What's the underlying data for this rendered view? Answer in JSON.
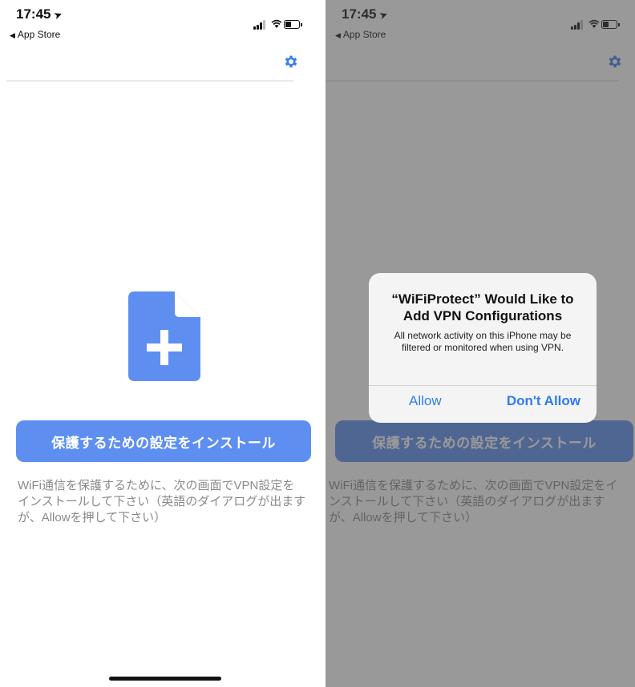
{
  "status_bar": {
    "time": "17:45",
    "location_arrow": "➤",
    "back_label": "App Store",
    "back_glyph": "◀"
  },
  "main": {
    "install_button_label": "保護するための設定をインストール",
    "description": "WiFi通信を保護するために、次の画面でVPN設定をインストールして下さい（英語のダイアログが出ますが、Allowを押して下さい）",
    "icon_color": "#5e8ff0"
  },
  "alert": {
    "title": "“WiFiProtect” Would Like to Add VPN Configurations",
    "message": "All network activity on this iPhone may be filtered or monitored when using VPN.",
    "allow_label": "Allow",
    "deny_label": "Don't Allow"
  }
}
